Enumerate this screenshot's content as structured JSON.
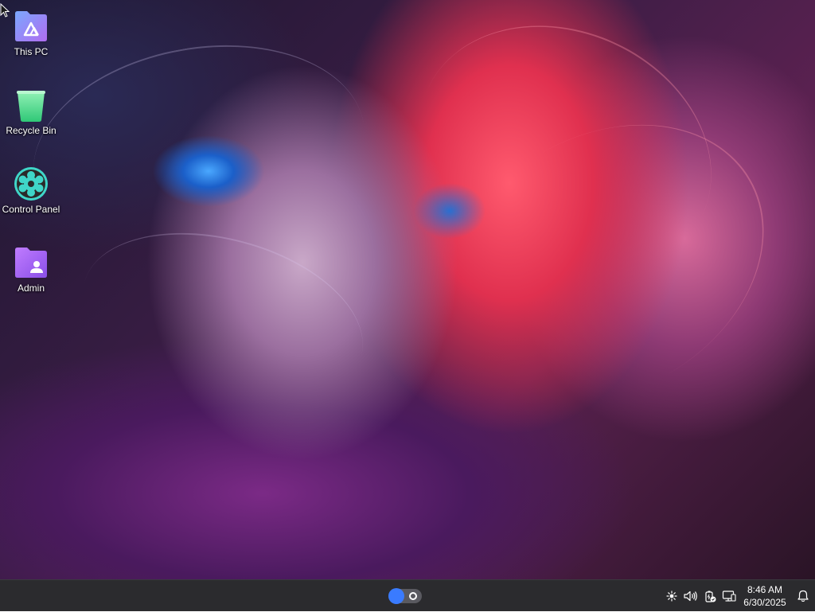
{
  "desktop": {
    "icons": [
      {
        "label": "This PC",
        "icon": "this-pc-icon"
      },
      {
        "label": "Recycle Bin",
        "icon": "recycle-bin-icon"
      },
      {
        "label": "Control Panel",
        "icon": "control-panel-icon"
      },
      {
        "label": "Admin",
        "icon": "user-folder-icon"
      }
    ]
  },
  "taskbar": {
    "toggle_icon": "toggle-switch-icon",
    "tray_icons": [
      "brightness-icon",
      "volume-icon",
      "battery-icon",
      "network-icon"
    ],
    "time": "8:46 AM",
    "date": "6/30/2025",
    "notification_icon": "bell-icon"
  },
  "colors": {
    "taskbar_bg": "#2b2b2e",
    "accent_blue": "#3a7bff",
    "folder_purple": "#a66cf0",
    "bin_green": "#4ddc8c"
  }
}
